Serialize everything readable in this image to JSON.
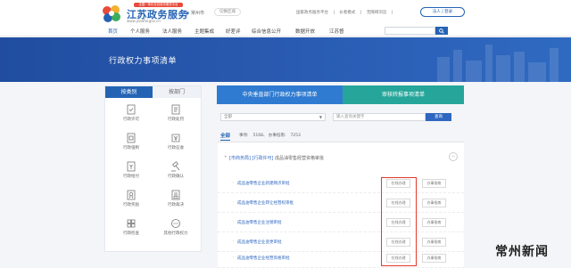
{
  "header": {
    "ribbon": "全国一体化在线政务服务平台",
    "site_title": "江苏政务服务",
    "site_url": "www.jszwfw.gov.cn",
    "location": "常州市",
    "switch_area": "切换区域",
    "links": [
      "国家政务服务平台",
      "|",
      "长者模式",
      "|",
      "无障碍浏览",
      "|"
    ],
    "login": "法人 | 登录"
  },
  "nav": {
    "items": [
      "首页",
      "个人服务",
      "法人服务",
      "主题集成",
      "好差评",
      "综合信息公开",
      "数据开放",
      "江苏督"
    ],
    "search_placeholder": ""
  },
  "banner": {
    "title": "行政权力事项清单"
  },
  "left_panel": {
    "tabs": [
      "按类别",
      "按部门"
    ],
    "categories": [
      {
        "label": "行政许可",
        "icon": "license-icon"
      },
      {
        "label": "行政处罚",
        "icon": "penalty-icon"
      },
      {
        "label": "行政强制",
        "icon": "enforcement-icon"
      },
      {
        "label": "行政征收",
        "icon": "levy-icon"
      },
      {
        "label": "行政给付",
        "icon": "payment-icon"
      },
      {
        "label": "行政确认",
        "icon": "gavel-icon"
      },
      {
        "label": "行政奖励",
        "icon": "award-icon"
      },
      {
        "label": "行政裁决",
        "icon": "ruling-icon"
      },
      {
        "label": "行政检查",
        "icon": "inspection-icon"
      },
      {
        "label": "其他行政权力",
        "icon": "other-icon"
      }
    ]
  },
  "tabs": {
    "central": "中央垂直部门行政权力事项清单",
    "approval": "审核转报事项清单"
  },
  "filter": {
    "select": "全部",
    "input_placeholder": "输入查询关键字",
    "button": "查询"
  },
  "stats": {
    "all": "全部",
    "items": [
      "事项:",
      "5168、 办事指南:",
      "7253"
    ]
  },
  "list": {
    "group": {
      "tag": "[市商务局]",
      "type": "[行政许可]",
      "title": "成品油零售经营资格审批",
      "toggle": "−"
    },
    "rows": [
      "成品油零售企业新建网点审批",
      "成品油零售企业转让经营权审批",
      "成品油零售企业注销审批",
      "成品油零售企业变更审批",
      "成品油零售企业经营资格审批"
    ],
    "online_label": "在线办理",
    "guide_label": "办事指南"
  },
  "watermark": "常州新闻",
  "colors": {
    "brand": "#2463b4",
    "teal": "#26a69a",
    "highlight": "#e2382c"
  }
}
